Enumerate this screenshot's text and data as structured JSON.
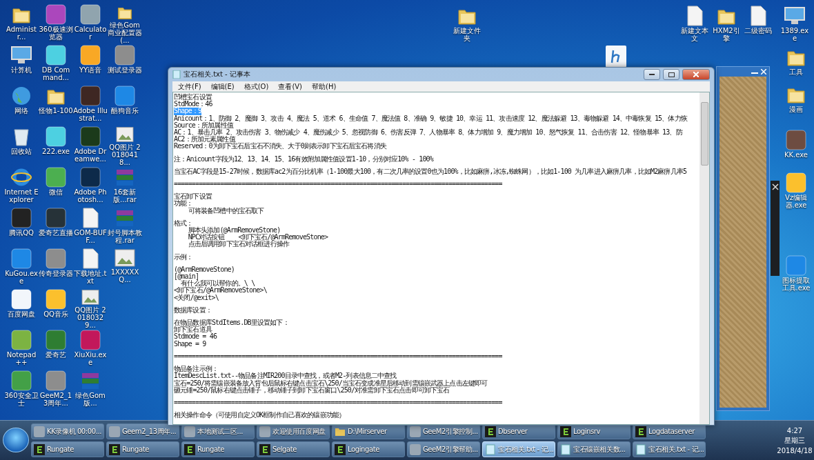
{
  "desktop_icons_left": [
    {
      "label": "Administr...",
      "kind": "folder"
    },
    {
      "label": "计算机",
      "kind": "computer"
    },
    {
      "label": "网络",
      "kind": "network"
    },
    {
      "label": "回收站",
      "kind": "trash"
    },
    {
      "label": "Internet Explorer",
      "kind": "browser"
    },
    {
      "label": "腾讯QQ",
      "kind": "app",
      "color": "#222222"
    },
    {
      "label": "KuGou.exe",
      "kind": "app",
      "color": "#1e88e5"
    },
    {
      "label": "百度网盘",
      "kind": "app",
      "color": "#f2f6fb"
    },
    {
      "label": "Notepad++",
      "kind": "app",
      "color": "#7cb342"
    },
    {
      "label": "360安全卫士",
      "kind": "app",
      "color": "#43a047"
    },
    {
      "label": "360极速浏览器",
      "kind": "app",
      "color": "#ab47bc"
    },
    {
      "label": "DB Command...",
      "kind": "app",
      "color": "#4dd0e1"
    },
    {
      "label": "怪物1-100",
      "kind": "folder"
    },
    {
      "label": "222.exe",
      "kind": "app",
      "color": "#4dd0e1"
    },
    {
      "label": "微信",
      "kind": "app",
      "color": "#4caf50"
    },
    {
      "label": "爱奇艺直播",
      "kind": "app",
      "color": "#263238"
    },
    {
      "label": "传奇登录器",
      "kind": "app",
      "color": "#8d8d8d"
    },
    {
      "label": "QQ音乐",
      "kind": "app",
      "color": "#fbc02d"
    },
    {
      "label": "爱奇艺",
      "kind": "app",
      "color": "#2e7d32"
    },
    {
      "label": "GeeM2_13周年...",
      "kind": "app",
      "color": "#8d8d8d"
    },
    {
      "label": "Calculator",
      "kind": "app",
      "color": "#90a4ae"
    },
    {
      "label": "YY语音",
      "kind": "app",
      "color": "#f9a825"
    },
    {
      "label": "Adobe Illustrat...",
      "kind": "app",
      "color": "#3e2723"
    },
    {
      "label": "Adobe Dreamwe...",
      "kind": "app",
      "color": "#1b3a1b"
    },
    {
      "label": "Adobe Photosh...",
      "kind": "app",
      "color": "#0d2a4a"
    },
    {
      "label": "GOM-BUFF...",
      "kind": "file"
    },
    {
      "label": "下载地址.txt",
      "kind": "file"
    },
    {
      "label": "QQ图片 20180329...",
      "kind": "image"
    },
    {
      "label": "XiuXiu.exe",
      "kind": "app",
      "color": "#c2185b"
    },
    {
      "label": "绿色Gom版...",
      "kind": "archive"
    },
    {
      "label": "绿色Gom商业配置器 (...",
      "kind": "folder"
    },
    {
      "label": "测试登录器",
      "kind": "app",
      "color": "#8d8d8d"
    },
    {
      "label": "酷狗音乐",
      "kind": "app",
      "color": "#1e88e5"
    },
    {
      "label": "QQ图片 20180418...",
      "kind": "image"
    },
    {
      "label": "16套新版...rar",
      "kind": "archive"
    },
    {
      "label": "封号脚本教程.rar",
      "kind": "archive"
    },
    {
      "label": "1XXXXXQ...",
      "kind": "image"
    }
  ],
  "desktop_icons_other": [
    {
      "label": "新建文件夹",
      "kind": "folder"
    },
    {
      "label": "新建文本文",
      "kind": "file"
    },
    {
      "label": "HXM2引擎",
      "kind": "folder"
    },
    {
      "label": "二级密码",
      "kind": "file"
    },
    {
      "label": "1389.exe",
      "kind": "computer"
    },
    {
      "label": "工具",
      "kind": "folder"
    },
    {
      "label": "漫画",
      "kind": "folder"
    },
    {
      "label": "KK.exe",
      "kind": "app",
      "color": "#6d4c41"
    },
    {
      "label": "Vz编辑器.exe",
      "kind": "app",
      "color": "#fbc02d"
    },
    {
      "label": "图标提取工具.exe",
      "kind": "app",
      "color": "#1e88e5"
    }
  ],
  "notepad": {
    "title": "宝石相关.txt - 记事本",
    "menu": [
      "文件(F)",
      "编辑(E)",
      "格式(O)",
      "查看(V)",
      "帮助(H)"
    ],
    "blocks": [
      {
        "lines": [
          {
            "text": "凹槽宝石设置",
            "selected": false
          },
          {
            "text": "StdMode：46",
            "selected": false
          },
          {
            "text": "Shape：9",
            "selected": true
          },
          {
            "text": "Anicount：1、防御 2、魔御 3、攻击 4、魔法 5、道术 6、生命值 7、魔法值 8、准确 9、敏捷 10、幸运 11、攻击速度 12、魔法躲避 13、毒物躲避 14、中毒恢复 15、体力恢",
            "selected": false
          },
          {
            "text": "Source：所加属性值",
            "selected": false
          },
          {
            "text": "AC：1、暴击几率 2、攻击伤害 3、物伤减少 4、魔伤减少 5、忽视防御 6、伤害反弹 7、人物暴率 8、体力增加 9、魔力增加 10、怒气恢复 11、合击伤害 12、怪物暴率 13、防",
            "selected": false
          },
          {
            "text": "AC2：所加元素属性值",
            "selected": false
          },
          {
            "text": "Reserved：0为卸下宝石后宝石不消失、大于0则表示卸下宝石后宝石将消失",
            "selected": false
          }
        ]
      },
      {
        "lines": [
          {
            "text": "注：Anicount字段为12、13、14、15、16有效附加属性值设置1-10，分别对应10% - 100%",
            "selected": false
          }
        ]
      },
      {
        "lines": [
          {
            "text": "当宝石AC字段是15-27时候，数据库ac2为百分比机率（1-100最大100，有二次几率的设置0也为100%，比如麻痹,冰冻,蜘蛛网），比如1-100 为几率进入麻痹几率，比如M2麻痹几率5",
            "selected": false
          }
        ]
      },
      {
        "lines": [
          {
            "text": "============================================================================================",
            "selected": false
          }
        ]
      },
      {
        "lines": [
          {
            "text": "宝石卸下设置",
            "selected": false
          },
          {
            "text": "功能：",
            "selected": false
          },
          {
            "text": "    可将装备凹槽中的宝石取下",
            "selected": false
          }
        ]
      },
      {
        "lines": [
          {
            "text": "格式：",
            "selected": false
          },
          {
            "text": "    脚本头添加(@ArmRemoveStone)",
            "selected": false
          },
          {
            "text": "    NPC对话按钮    <卸下宝石/@ArmRemoveStone>",
            "selected": false
          },
          {
            "text": "    点击后调用卸下宝石对话框进行操作",
            "selected": false
          }
        ]
      },
      {
        "lines": [
          {
            "text": "示例：",
            "selected": false
          }
        ]
      },
      {
        "lines": [
          {
            "text": "(@ArmRemoveStone)",
            "selected": false
          },
          {
            "text": "[@main]",
            "selected": false
          },
          {
            "text": "  有什么我可以帮你的。\\ \\",
            "selected": false
          },
          {
            "text": "<卸下宝石/@ArmRemoveStone>\\",
            "selected": false
          },
          {
            "text": "<关闭/@exit>\\",
            "selected": false
          }
        ]
      },
      {
        "lines": [
          {
            "text": "数据库设置：",
            "selected": false
          }
        ]
      },
      {
        "lines": [
          {
            "text": "在物品数据库StdItems.DB里设置如下：",
            "selected": false
          },
          {
            "text": "卸下宝石道具",
            "selected": false
          },
          {
            "text": "Stdmode = 46",
            "selected": false
          },
          {
            "text": "Shape = 9",
            "selected": false
          }
        ]
      },
      {
        "lines": [
          {
            "text": "============================================================================================",
            "selected": false
          }
        ]
      },
      {
        "lines": [
          {
            "text": "物品备注示例：",
            "selected": false
          },
          {
            "text": "ItemDescList.txt--物品备注MIR200目录中查找，或者M2-列表信息二中查找",
            "selected": false
          },
          {
            "text": "宝石=250/将需镶嵌装备放入背包后鼠标右键点击宝石\\250/当宝石变成准星后移动到需镶嵌武器上点击左键即可",
            "selected": false
          },
          {
            "text": "砸元锤=250/鼠标右键点击锤子，移动锤子到卸下宝石窗口\\250/对准需卸下宝石点击即可卸下宝石",
            "selected": false
          }
        ]
      },
      {
        "lines": [
          {
            "text": "============================================================================================",
            "selected": false
          }
        ]
      },
      {
        "lines": [
          {
            "text": "相关操作命令（可使用自定义OK框制作自己喜欢的镶嵌功能）",
            "selected": false
          }
        ]
      }
    ]
  },
  "taskbar": {
    "rows": [
      [
        {
          "label": "KK录像机 00:00...",
          "kind": "app",
          "selected": false
        },
        {
          "label": "Geem2_13周年...",
          "kind": "app",
          "selected": false
        },
        {
          "label": "本地测试二区...",
          "kind": "app",
          "selected": false
        },
        {
          "label": "欢迎使用百度网盘",
          "kind": "app",
          "selected": false
        },
        {
          "label": "D:\\Mirserver",
          "kind": "folder",
          "selected": false
        },
        {
          "label": "GeeM2引擎控制...",
          "kind": "app",
          "selected": false
        },
        {
          "label": "Dbserver",
          "kind": "server",
          "selected": false
        },
        {
          "label": "Loginsrv",
          "kind": "server",
          "selected": false
        },
        {
          "label": "Logdataserver",
          "kind": "server",
          "selected": false
        }
      ],
      [
        {
          "label": "Rungate",
          "kind": "server",
          "selected": false
        },
        {
          "label": "Rungate",
          "kind": "server",
          "selected": false
        },
        {
          "label": "Rungate",
          "kind": "server",
          "selected": false
        },
        {
          "label": "Selgate",
          "kind": "server",
          "selected": false
        },
        {
          "label": "Logingate",
          "kind": "server",
          "selected": false
        },
        {
          "label": "GeeM2引擎帮助...",
          "kind": "app",
          "selected": false
        },
        {
          "label": "宝石相关.txt - 记...",
          "kind": "notepad",
          "selected": true
        },
        {
          "label": "宝石镶嵌相关数...",
          "kind": "notepad",
          "selected": false
        },
        {
          "label": "宝石相关.txt - 记...",
          "kind": "notepad",
          "selected": false
        }
      ]
    ],
    "clock": {
      "time": "4:27",
      "day": "星期三",
      "date": "2018/4/18"
    }
  }
}
